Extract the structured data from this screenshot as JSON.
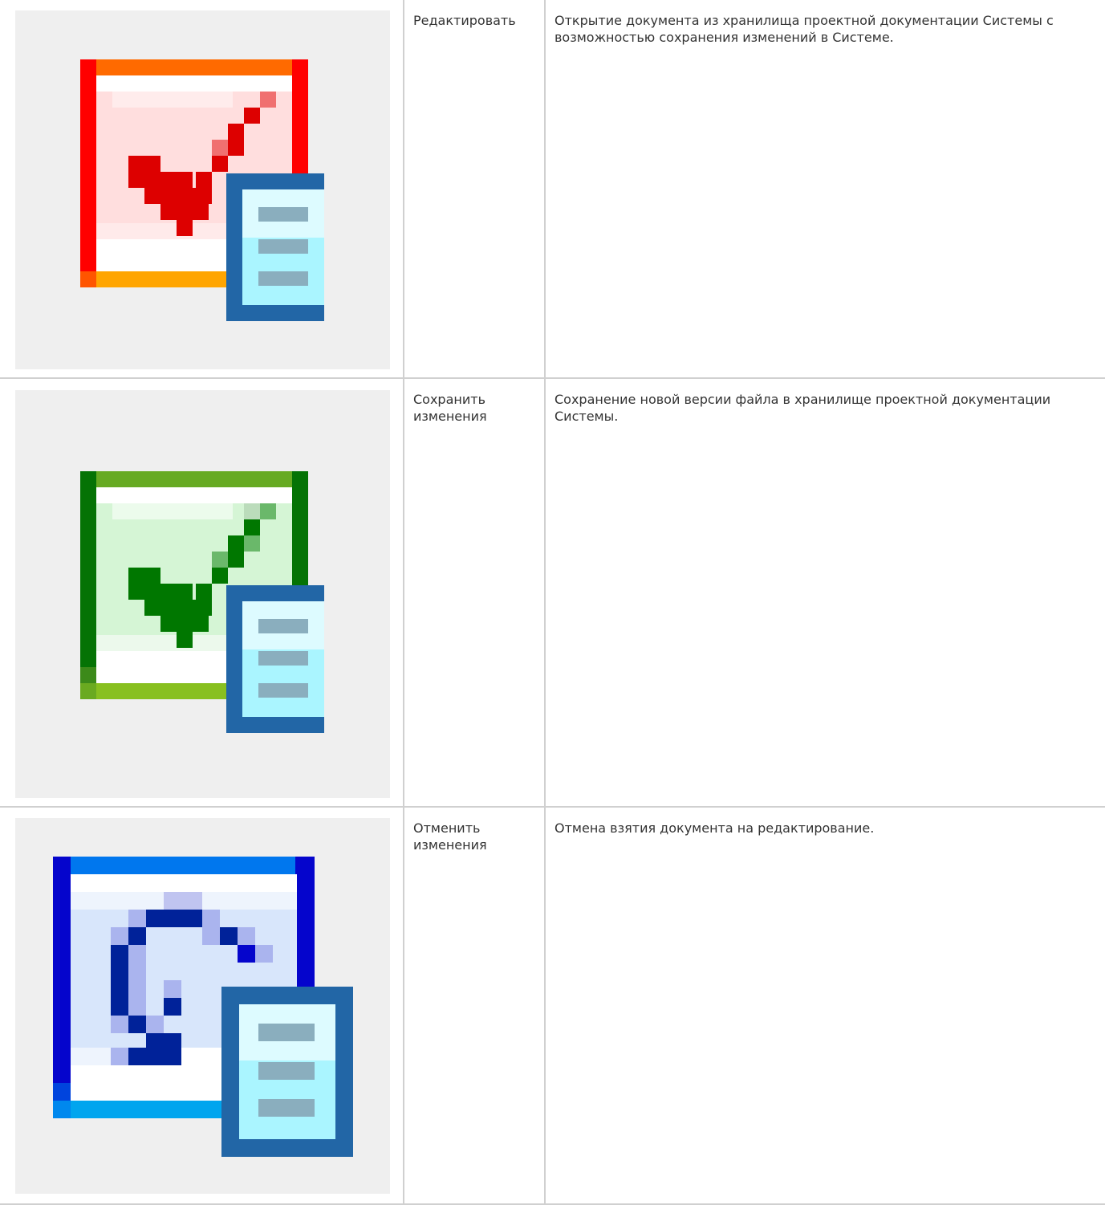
{
  "rows": [
    {
      "action": "Редактировать",
      "description": "Открытие документа из хранилища проектной документации Системы с возможностью сохранения изменений в Системе.",
      "icon": "edit-document-icon",
      "icon_colors": {
        "frame": "#ff0000",
        "top_band": "#ff6a00",
        "bottom_band": "#ffa500",
        "check": "#dd0000",
        "fill": "#ffdede"
      }
    },
    {
      "action": "Сохранить изменения",
      "description": "Сохранение новой версии файла в хранилище проектной документации Системы.",
      "icon": "save-document-icon",
      "icon_colors": {
        "frame": "#057305",
        "top_band": "#66aa22",
        "bottom_band": "#88c020",
        "check": "#007700",
        "fill": "#d5f5d5"
      }
    },
    {
      "action": "Отменить изменения",
      "description": "Отмена взятия документа на редактирование.",
      "icon": "undo-document-icon",
      "icon_colors": {
        "frame": "#0505cc",
        "top_band": "#0077ee",
        "bottom_band": "#00a5ee",
        "arrow": "#002299",
        "fill": "#d8e6fb"
      }
    }
  ],
  "page_icon_colors": {
    "panel_bg": "#efefef",
    "doc_frame": "#2266a6",
    "doc_fill": "#aaf5ff",
    "doc_lines": "#8aaebe"
  }
}
